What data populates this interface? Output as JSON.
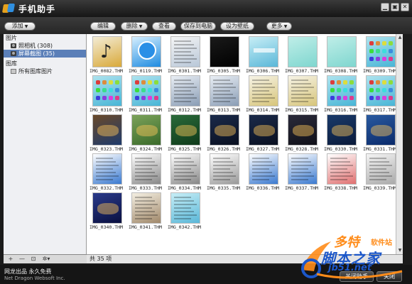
{
  "window": {
    "title": "手机助手",
    "controls": [
      "▁",
      "▣",
      "✕"
    ]
  },
  "toolbar": {
    "add": "添加",
    "edit": "编辑",
    "delete": "删除",
    "view": "查看",
    "save_to_pc": "保存到电脑",
    "set_wallpaper": "设为壁纸",
    "more": "更多"
  },
  "sidebar": {
    "photos_header": "图片",
    "items": [
      {
        "label": "照相机 (308)",
        "selected": false,
        "icon": "camera-icon"
      },
      {
        "label": "屏幕截图 (35)",
        "selected": true,
        "icon": "camera-icon"
      }
    ],
    "library_header": "图库",
    "library_items": [
      {
        "label": "所有图库图片",
        "icon": "library-icon"
      }
    ],
    "bottom_tools": [
      "+",
      "—",
      "⊡",
      "✲▾"
    ]
  },
  "grid": {
    "thumbnails": [
      {
        "name": "IMG_0082.THM",
        "c1": "#f3ecd6",
        "c2": "#d9a93a",
        "kind": "music"
      },
      {
        "name": "IMG_0119.THM",
        "c1": "#d6efff",
        "c2": "#1e8be0",
        "kind": "doraemon"
      },
      {
        "name": "IMG_0301.THM",
        "c1": "#f5f5f5",
        "c2": "#b8c7d8",
        "kind": "settings"
      },
      {
        "name": "IMG_0305.THM",
        "c1": "#1a1a1a",
        "c2": "#000000",
        "kind": "dark"
      },
      {
        "name": "IMG_0306.THM",
        "c1": "#c7eef6",
        "c2": "#5ab7d8",
        "kind": "market"
      },
      {
        "name": "IMG_0307.THM",
        "c1": "#bfeee8",
        "c2": "#7fd6cf",
        "kind": "plain"
      },
      {
        "name": "IMG_0308.THM",
        "c1": "#bfeee8",
        "c2": "#7fd6cf",
        "kind": "plain"
      },
      {
        "name": "IMG_0309.THM",
        "c1": "#aee3ee",
        "c2": "#48b5d6",
        "kind": "icons"
      },
      {
        "name": "IMG_0310.THM",
        "c1": "#aee3ee",
        "c2": "#48b5d6",
        "kind": "icons"
      },
      {
        "name": "IMG_0311.THM",
        "c1": "#aee3ee",
        "c2": "#48b5d6",
        "kind": "icons"
      },
      {
        "name": "IMG_0312.THM",
        "c1": "#e9eef4",
        "c2": "#8a9db5",
        "kind": "settings"
      },
      {
        "name": "IMG_0313.THM",
        "c1": "#e9eef4",
        "c2": "#8a9db5",
        "kind": "settings"
      },
      {
        "name": "IMG_0314.THM",
        "c1": "#f6f3e6",
        "c2": "#d7c57a",
        "kind": "doc"
      },
      {
        "name": "IMG_0315.THM",
        "c1": "#f6f3e6",
        "c2": "#d7c57a",
        "kind": "doc"
      },
      {
        "name": "IMG_0316.THM",
        "c1": "#aee3ee",
        "c2": "#48b5d6",
        "kind": "icons"
      },
      {
        "name": "IMG_0317.THM",
        "c1": "#aee3ee",
        "c2": "#48b5d6",
        "kind": "icons"
      },
      {
        "name": "IMG_0323.THM",
        "c1": "#6a4a2a",
        "c2": "#1e3a6a",
        "kind": "game"
      },
      {
        "name": "IMG_0324.THM",
        "c1": "#7ba25a",
        "c2": "#3a6a2a",
        "kind": "game"
      },
      {
        "name": "IMG_0325.THM",
        "c1": "#2a6a3a",
        "c2": "#0f3a1a",
        "kind": "game"
      },
      {
        "name": "IMG_0326.THM",
        "c1": "#1a2a4a",
        "c2": "#0a1020",
        "kind": "game"
      },
      {
        "name": "IMG_0327.THM",
        "c1": "#1a2a4a",
        "c2": "#0a1020",
        "kind": "game"
      },
      {
        "name": "IMG_0328.THM",
        "c1": "#2a2a3a",
        "c2": "#101018",
        "kind": "game"
      },
      {
        "name": "IMG_0330.THM",
        "c1": "#1a3a6a",
        "c2": "#0a1a3a",
        "kind": "game"
      },
      {
        "name": "IMG_0331.THM",
        "c1": "#2a5aa0",
        "c2": "#0a2a6a",
        "kind": "game"
      },
      {
        "name": "IMG_0332.THM",
        "c1": "#ffffff",
        "c2": "#3b7ad0",
        "kind": "web"
      },
      {
        "name": "IMG_0333.THM",
        "c1": "#ffffff",
        "c2": "#888888",
        "kind": "doc"
      },
      {
        "name": "IMG_0334.THM",
        "c1": "#ffffff",
        "c2": "#888888",
        "kind": "doc"
      },
      {
        "name": "IMG_0335.THM",
        "c1": "#ffffff",
        "c2": "#999999",
        "kind": "doc"
      },
      {
        "name": "IMG_0336.THM",
        "c1": "#ffffff",
        "c2": "#3b7ad0",
        "kind": "web"
      },
      {
        "name": "IMG_0337.THM",
        "c1": "#ffffff",
        "c2": "#3b7ad0",
        "kind": "web"
      },
      {
        "name": "IMG_0338.THM",
        "c1": "#ffffff",
        "c2": "#e07070",
        "kind": "web"
      },
      {
        "name": "IMG_0339.THM",
        "c1": "#f4f4f4",
        "c2": "#aaaaaa",
        "kind": "doc"
      },
      {
        "name": "IMG_0340.THM",
        "c1": "#2a3a8a",
        "c2": "#0a1040",
        "kind": "game"
      },
      {
        "name": "IMG_0341.THM",
        "c1": "#f4efe2",
        "c2": "#a0886a",
        "kind": "doc"
      },
      {
        "name": "IMG_0342.THM",
        "c1": "#c7eef6",
        "c2": "#5ab7d8",
        "kind": "web"
      }
    ]
  },
  "status": {
    "count_text": "共 35 项"
  },
  "footer": {
    "line1": "网龙出品 永久免费",
    "line2": "Net Dragon Websoft Inc.",
    "btn_left": "关闭助手",
    "btn_right": "关闭"
  },
  "watermark": {
    "brand": "多特",
    "brand_suffix": "软件站",
    "main": "脚本之家",
    "url": "jb51.net"
  }
}
